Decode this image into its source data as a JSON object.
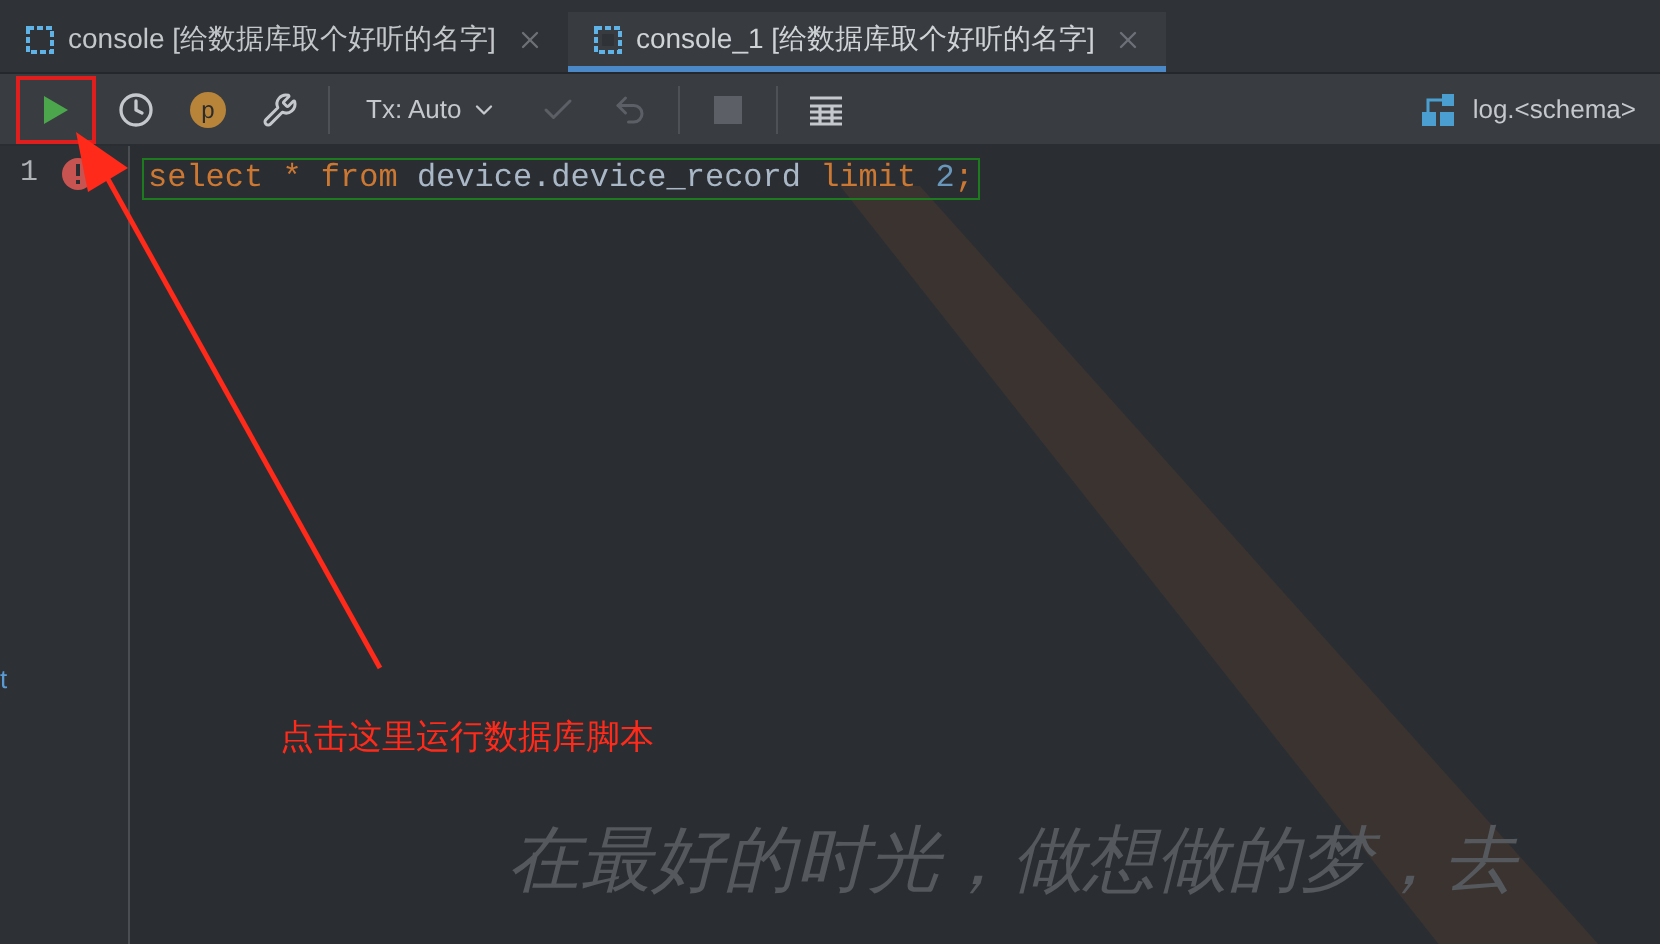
{
  "tabs": [
    {
      "label": "console [给数据库取个好听的名字]",
      "selected": false
    },
    {
      "label": "console_1 [给数据库取个好听的名字]",
      "selected": true
    }
  ],
  "toolbar": {
    "buttons": [
      {
        "kind": "run",
        "disabled": false,
        "highlighted": true
      },
      {
        "kind": "history",
        "disabled": false,
        "highlighted": false
      },
      {
        "kind": "profile",
        "label": "p",
        "disabled": false,
        "highlighted": false
      },
      {
        "kind": "settings",
        "disabled": false,
        "highlighted": false
      },
      {
        "kind": "divider"
      },
      {
        "kind": "dropdown",
        "label": "Tx: Auto",
        "disabled": false,
        "highlighted": false
      },
      {
        "kind": "commit",
        "disabled": true,
        "highlighted": false
      },
      {
        "kind": "rollback",
        "disabled": true,
        "highlighted": false
      },
      {
        "kind": "divider"
      },
      {
        "kind": "stop",
        "disabled": true,
        "highlighted": false
      },
      {
        "kind": "divider"
      },
      {
        "kind": "table",
        "disabled": false,
        "highlighted": false
      }
    ],
    "schema": "log.<schema>"
  },
  "editor": {
    "lines": [
      {
        "number": "1",
        "error": true,
        "tokens": [
          {
            "kind": "keyword",
            "text": "select "
          },
          {
            "kind": "keyword",
            "text": "* "
          },
          {
            "kind": "keyword",
            "text": "from "
          },
          {
            "kind": "plain",
            "text": "device.device_record "
          },
          {
            "kind": "keyword",
            "text": "limit "
          },
          {
            "kind": "number",
            "text": "2"
          },
          {
            "kind": "punct",
            "text": ";"
          }
        ]
      }
    ]
  },
  "sidebar_fragment": "t",
  "annotation": {
    "text": "点击这里运行数据库脚本"
  },
  "background_text": "在最好的时光，做想做的梦，去"
}
